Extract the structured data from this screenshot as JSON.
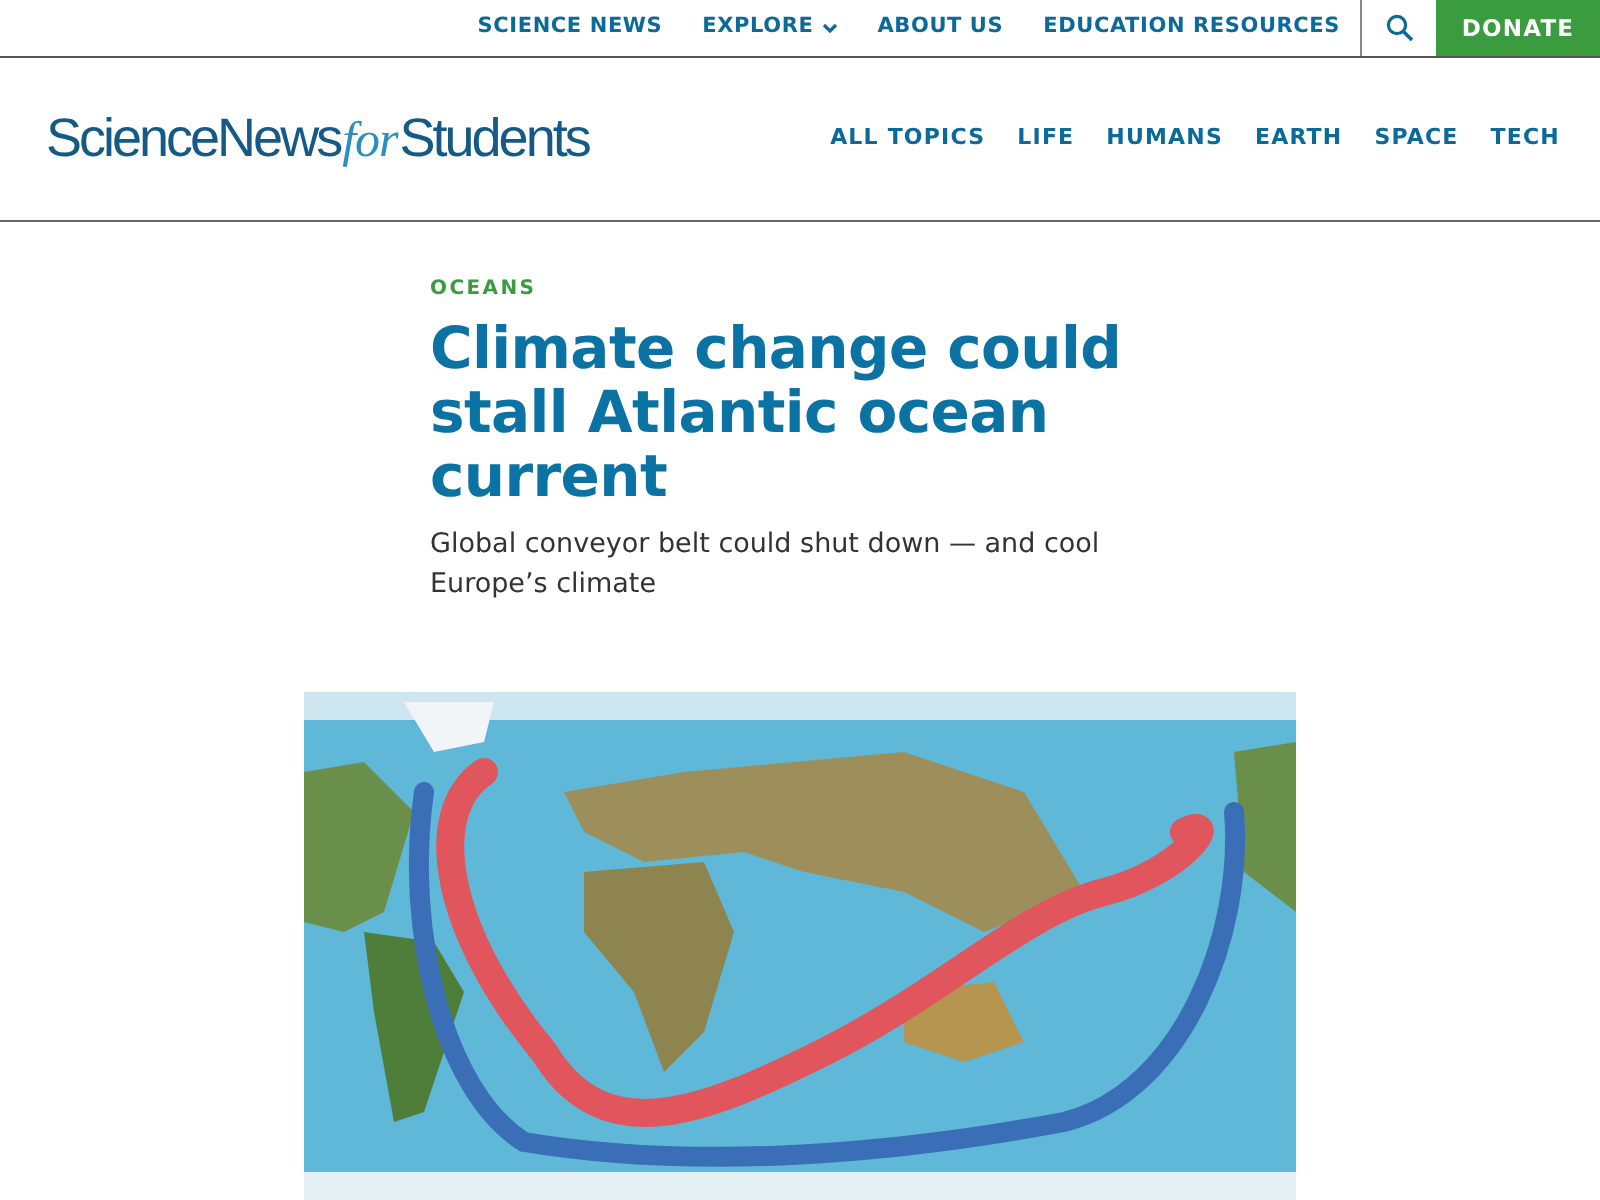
{
  "utility_nav": {
    "links": [
      {
        "label": "SCIENCE NEWS",
        "has_dropdown": false
      },
      {
        "label": "EXPLORE",
        "has_dropdown": true
      },
      {
        "label": "ABOUT US",
        "has_dropdown": false
      },
      {
        "label": "EDUCATION RESOURCES",
        "has_dropdown": false
      }
    ],
    "donate": "DONATE"
  },
  "header": {
    "logo": [
      {
        "text": "ScienceNews",
        "italic": false
      },
      {
        "text": "for",
        "italic": true
      },
      {
        "text": "Students",
        "italic": false
      }
    ],
    "topics": [
      "ALL TOPICS",
      "LIFE",
      "HUMANS",
      "EARTH",
      "SPACE",
      "TECH"
    ]
  },
  "article": {
    "category": "OCEANS",
    "title": "Climate change could stall Atlantic ocean current",
    "subtitle": "Global conveyor belt could shut down — and cool Europe’s climate"
  }
}
